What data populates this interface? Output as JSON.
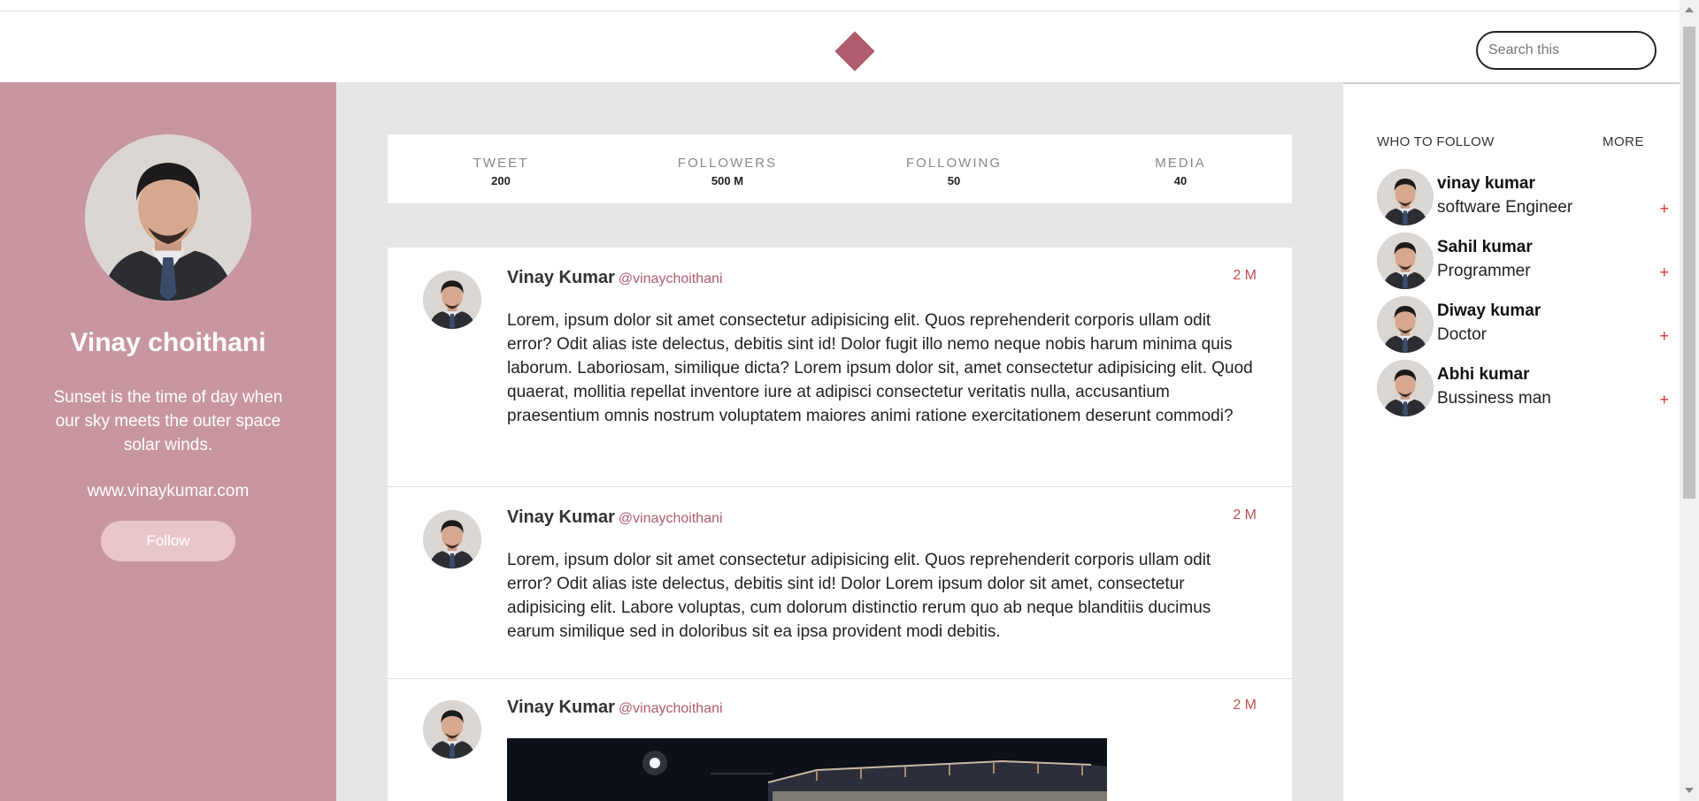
{
  "colors": {
    "accent": "#b05c6e",
    "sidebar_bg": "#c8969f",
    "feed_bg": "#e6e6e6",
    "time": "#c25050",
    "add": "#e03030"
  },
  "header": {
    "logo_icon": "diamond-logo-icon",
    "search_placeholder": "Search this"
  },
  "profile": {
    "name": "Vinay choithani",
    "bio": "Sunset is the time of day when our sky meets the outer space solar winds.",
    "website": "www.vinaykumar.com",
    "follow_label": "Follow"
  },
  "stats": [
    {
      "label": "TWEET",
      "value": "200"
    },
    {
      "label": "FOLLOWERS",
      "value": "500 M"
    },
    {
      "label": "FOLLOWING",
      "value": "50"
    },
    {
      "label": "MEDIA",
      "value": "40"
    }
  ],
  "tweets": [
    {
      "name": "Vinay Kumar",
      "handle": "@vinaychoithani",
      "time": "2 M",
      "text": "Lorem, ipsum dolor sit amet consectetur adipisicing elit. Quos reprehenderit corporis ullam odit error? Odit alias iste delectus, debitis sint id! Dolor fugit illo nemo neque nobis harum minima quis laborum. Laboriosam, similique dicta? Lorem ipsum dolor sit, amet consectetur adipisicing elit. Quod quaerat, mollitia repellat inventore iure at adipisci consectetur veritatis nulla, accusantium praesentium omnis nostrum voluptatem maiores animi ratione exercitationem deserunt commodi?"
    },
    {
      "name": "Vinay Kumar",
      "handle": "@vinaychoithani",
      "time": "2 M",
      "text": "Lorem, ipsum dolor sit amet consectetur adipisicing elit. Quos reprehenderit corporis ullam odit error? Odit alias iste delectus, debitis sint id! Dolor Lorem ipsum dolor sit amet, consectetur adipisicing elit. Labore voluptas, cum dolorum distinctio rerum quo ab neque blanditiis ducimus earum similique sed in doloribus sit ea ipsa provident modi debitis."
    },
    {
      "name": "Vinay Kumar",
      "handle": "@vinaychoithani",
      "time": "2 M",
      "text": ""
    }
  ],
  "who_to_follow": {
    "title": "WHO TO FOLLOW",
    "more": "MORE",
    "add_symbol": "+",
    "items": [
      {
        "name": "vinay kumar",
        "role": "software Engineer"
      },
      {
        "name": "Sahil kumar",
        "role": "Programmer"
      },
      {
        "name": "Diway kumar",
        "role": "Doctor"
      },
      {
        "name": "Abhi kumar",
        "role": "Bussiness man"
      }
    ]
  }
}
